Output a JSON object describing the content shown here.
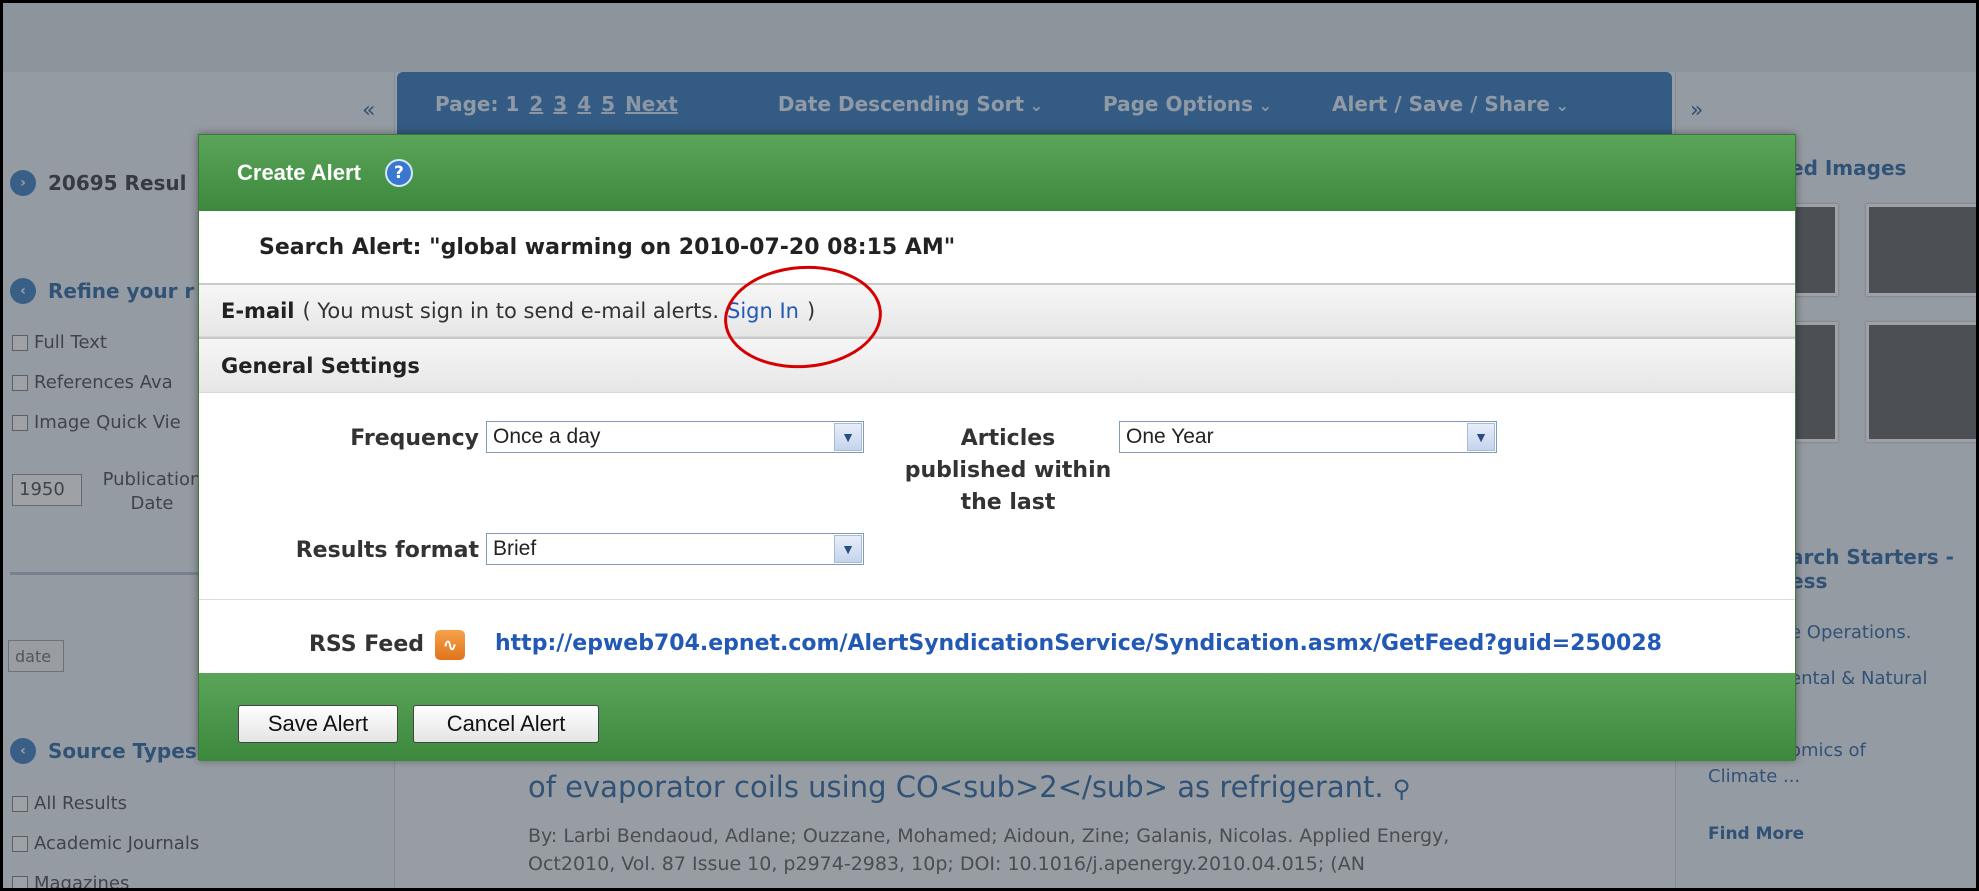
{
  "background": {
    "toolbar": {
      "page_label": "Page: 1",
      "pages": [
        "2",
        "3",
        "4",
        "5",
        "Next"
      ],
      "sort": "Date Descending Sort",
      "page_options": "Page Options",
      "alert_save_share": "Alert / Save / Share"
    },
    "collapse_left": "«",
    "collapse_right": "»",
    "results_count": "20695 Resul",
    "refine": "Refine your r",
    "limiters": [
      "Full Text",
      "References Ava",
      "Image Quick Vie"
    ],
    "year_from": "1950",
    "pub_date_label": "Publication Date",
    "update_button": "date",
    "source_types": "Source Types",
    "source_items": [
      "All Results",
      "Academic Journals",
      "Magazines"
    ],
    "related_images": "ed Images",
    "search_starters": "arch Starters - ess",
    "right_links": [
      "e Operations.",
      "ental & Natural",
      "omics of",
      "Climate ..."
    ],
    "find_more": "Find More",
    "article_title": "of evaporator coils using CO<sub>2</sub> as refrigerant.",
    "article_meta_line1": "By: Larbi Bendaoud, Adlane; Ouzzane, Mohamed; Aidoun, Zine; Galanis, Nicolas. Applied Energy,",
    "article_meta_line2": "Oct2010, Vol. 87 Issue 10, p2974-2983, 10p; DOI: 10.1016/j.apenergy.2010.04.015; (AN"
  },
  "modal": {
    "title": "Create Alert",
    "help_icon": "?",
    "search_alert": "Search Alert: \"global warming on 2010-07-20 08:15 AM\"",
    "email": {
      "label": "E-mail",
      "note_before": "( You must sign in to send e-mail alerts.",
      "sign_in_link": "Sign In",
      "note_after": ")"
    },
    "general_settings": "General Settings",
    "frequency": {
      "label": "Frequency",
      "value": "Once a day"
    },
    "articles_published": {
      "label": "Articles published within the last",
      "value": "One Year"
    },
    "results_format": {
      "label": "Results format",
      "value": "Brief"
    },
    "rss": {
      "label": "RSS Feed",
      "url": "http://epweb704.epnet.com/AlertSyndicationService/Syndication.asmx/GetFeed?guid=250028"
    },
    "save_button": "Save Alert",
    "cancel_button": "Cancel Alert"
  },
  "colors": {
    "header_green": "#4a974a",
    "link_blue": "#2259b5",
    "annotation_red": "#d60000"
  }
}
